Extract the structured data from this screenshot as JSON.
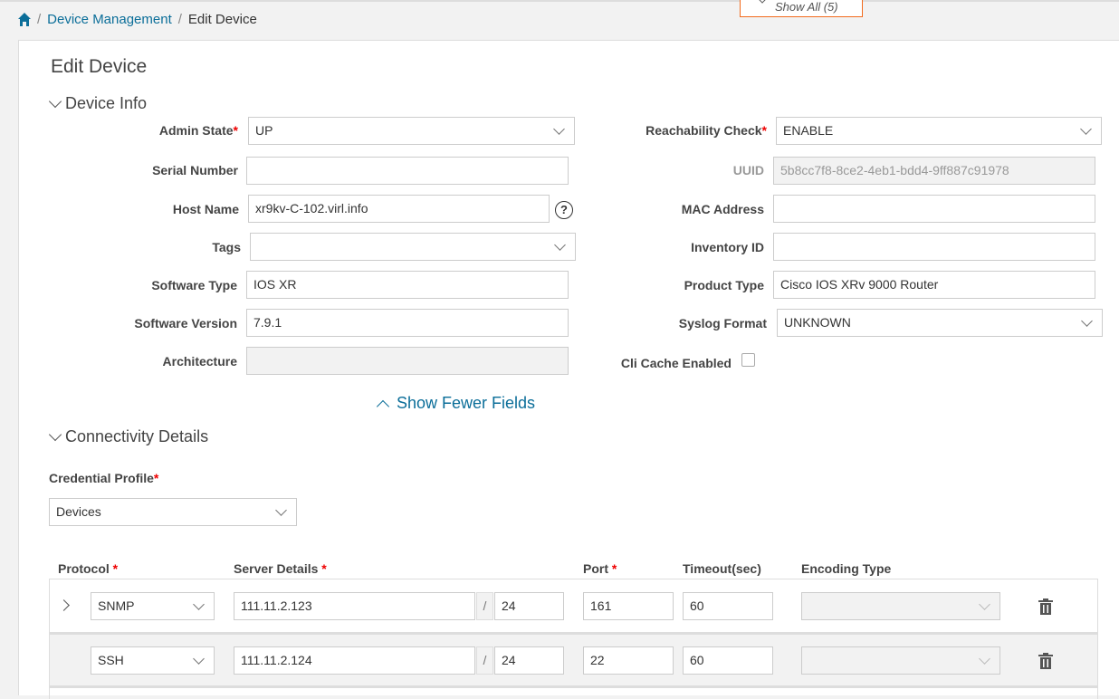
{
  "breadcrumb": {
    "parent": "Device Management",
    "current": "Edit Device"
  },
  "show_all": "Show All (5)",
  "title": "Edit Device",
  "device_info": {
    "heading": "Device Info",
    "admin_state": {
      "label": "Admin State",
      "value": "UP"
    },
    "serial_number": {
      "label": "Serial Number",
      "value": ""
    },
    "host_name": {
      "label": "Host Name",
      "value": "xr9kv-C-102.virl.info"
    },
    "tags": {
      "label": "Tags",
      "value": ""
    },
    "software_type": {
      "label": "Software Type",
      "value": "IOS XR"
    },
    "software_version": {
      "label": "Software Version",
      "value": "7.9.1"
    },
    "architecture": {
      "label": "Architecture",
      "value": ""
    },
    "reachability_check": {
      "label": "Reachability Check",
      "value": "ENABLE"
    },
    "uuid": {
      "label": "UUID",
      "value": "5b8cc7f8-8ce2-4eb1-bdd4-9ff887c91978"
    },
    "mac_address": {
      "label": "MAC Address",
      "value": ""
    },
    "inventory_id": {
      "label": "Inventory ID",
      "value": ""
    },
    "product_type": {
      "label": "Product Type",
      "value": "Cisco IOS XRv 9000 Router"
    },
    "syslog_format": {
      "label": "Syslog Format",
      "value": "UNKNOWN"
    },
    "cli_cache": {
      "label": "Cli Cache Enabled",
      "checked": false
    },
    "help": "?",
    "show_fewer": "Show Fewer Fields"
  },
  "connectivity": {
    "heading": "Connectivity Details",
    "credential_label": "Credential Profile",
    "credential_value": "Devices",
    "required_mark": "*",
    "columns": {
      "protocol": "Protocol",
      "server": "Server Details",
      "port": "Port",
      "timeout": "Timeout(sec)",
      "encoding": "Encoding Type"
    },
    "slash": "/",
    "rows": [
      {
        "protocol": "SNMP",
        "ip": "111.11.2.123",
        "mask": "24",
        "port": "161",
        "timeout": "60",
        "encoding": ""
      },
      {
        "protocol": "SSH",
        "ip": "111.11.2.124",
        "mask": "24",
        "port": "22",
        "timeout": "60",
        "encoding": ""
      }
    ]
  }
}
